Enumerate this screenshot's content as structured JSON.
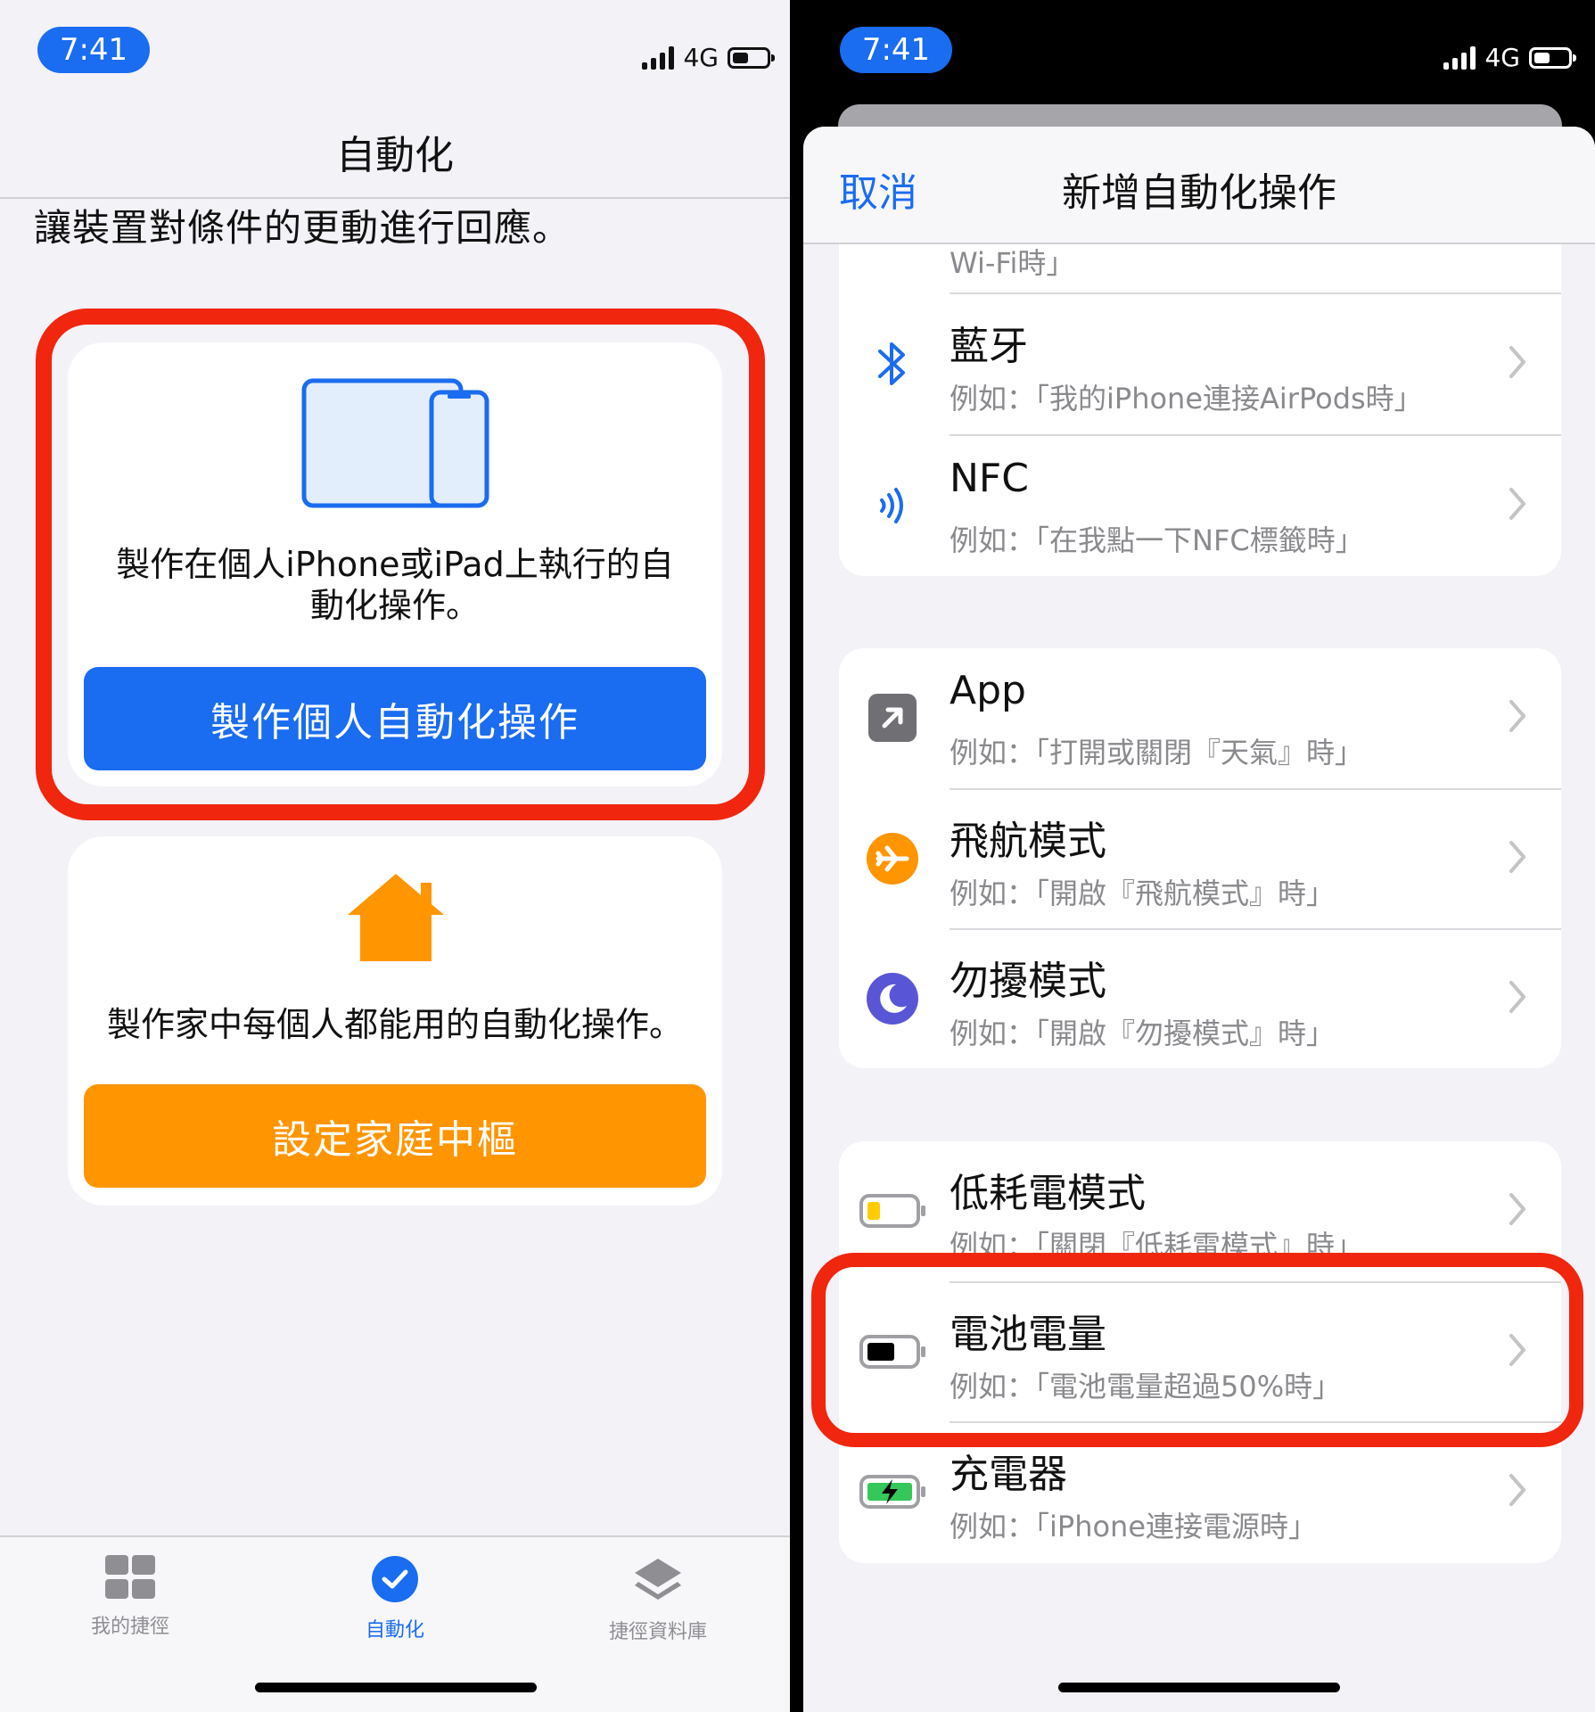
{
  "left": {
    "status": {
      "time": "7:41",
      "network": "4G"
    },
    "nav_title": "自動化",
    "subtitle": "讓裝置對條件的更動進行回應。",
    "personal_card": {
      "description_line1": "製作在個人iPhone或iPad上執行的自",
      "description_line2": "動化操作。",
      "button_label": "製作個人自動化操作"
    },
    "home_card": {
      "description": "製作家中每個人都能用的自動化操作。",
      "button_label": "設定家庭中樞"
    },
    "tabs": [
      {
        "label": "我的捷徑",
        "icon": "grid-icon"
      },
      {
        "label": "自動化",
        "icon": "checkmark-circle-icon"
      },
      {
        "label": "捷徑資料庫",
        "icon": "layers-icon"
      }
    ],
    "active_tab": "自動化"
  },
  "right": {
    "status": {
      "time": "7:41",
      "network": "4G"
    },
    "cancel_label": "取消",
    "sheet_title": "新增自動化操作",
    "partial_row_subtitle": "Wi-Fi時」",
    "group1": [
      {
        "title": "藍牙",
        "subtitle": "例如：「我的iPhone連接AirPods時」",
        "icon": "bluetooth-icon"
      },
      {
        "title": "NFC",
        "subtitle": "例如：「在我點一下NFC標籤時」",
        "icon": "nfc-icon"
      }
    ],
    "group2": [
      {
        "title": "App",
        "subtitle": "例如：「打開或關閉『天氣』時」",
        "icon": "app-arrow-icon"
      },
      {
        "title": "飛航模式",
        "subtitle": "例如：「開啟『飛航模式』時」",
        "icon": "airplane-icon"
      },
      {
        "title": "勿擾模式",
        "subtitle": "例如：「開啟『勿擾模式』時」",
        "icon": "moon-icon"
      }
    ],
    "group3": [
      {
        "title": "低耗電模式",
        "subtitle": "例如：「關閉『低耗電模式』時」",
        "icon": "low-battery-icon"
      },
      {
        "title": "電池電量",
        "subtitle": "例如：「電池電量超過50%時」",
        "icon": "battery-icon"
      },
      {
        "title": "充電器",
        "subtitle": "例如：「iPhone連接電源時」",
        "icon": "charging-icon"
      }
    ]
  },
  "colors": {
    "blue": "#1a6cf0",
    "orange": "#ff9500",
    "highlight_red": "#f0260f",
    "indigo": "#5856d6",
    "green": "#34c759",
    "yellow": "#ffcc00"
  }
}
